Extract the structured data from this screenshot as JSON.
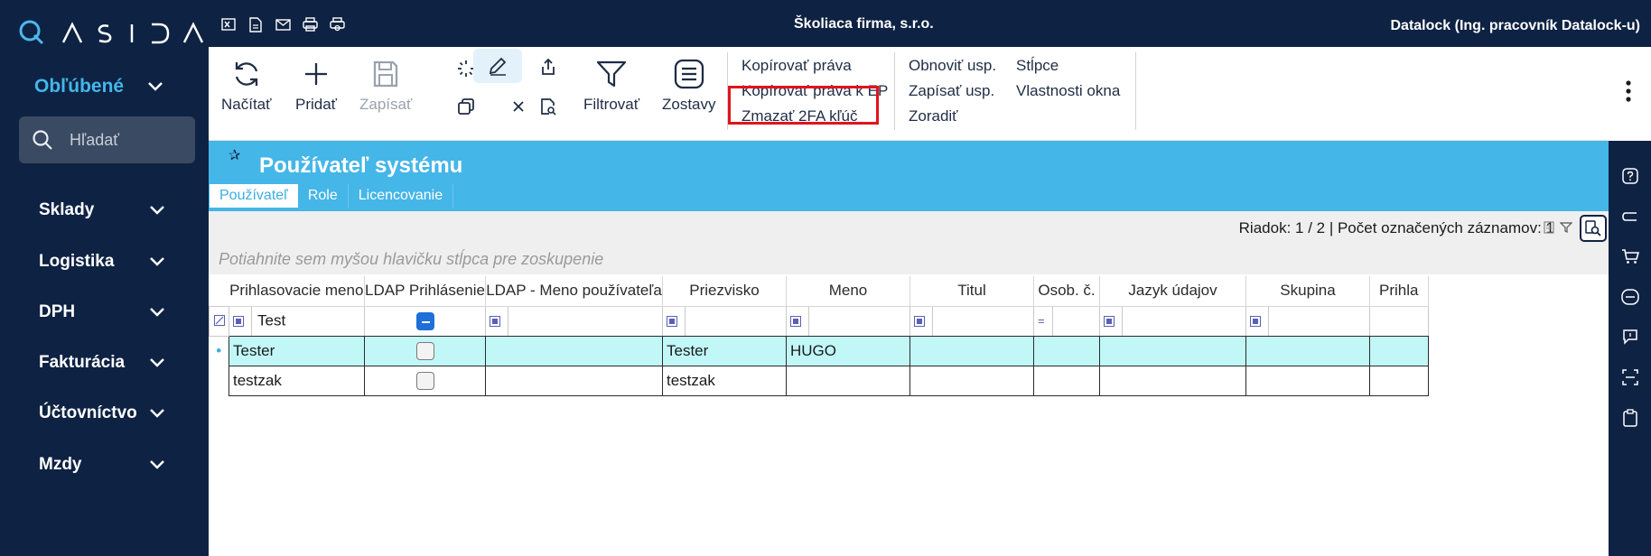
{
  "app": {
    "company": "Školiaca firma, s.r.o.",
    "user": "Datalock (Ing. pracovník Datalock-u)"
  },
  "sidebar": {
    "favorites_label": "Obľúbené",
    "search_placeholder": "Hľadať",
    "items": [
      {
        "label": "Sklady"
      },
      {
        "label": "Logistika"
      },
      {
        "label": "DPH"
      },
      {
        "label": "Fakturácia"
      },
      {
        "label": "Účtovníctvo"
      },
      {
        "label": "Mzdy"
      }
    ]
  },
  "ribbon": {
    "reload": "Načítať",
    "add": "Pridať",
    "save": "Zapísať",
    "filter": "Filtrovať",
    "reports": "Zostavy",
    "copy_rights": "Kopírovať práva",
    "copy_rights_ep": "Kopírovať práva k EP",
    "delete_2fa": "Zmazať 2FA kľúč",
    "refresh_settings": "Obnoviť usp.",
    "write_settings": "Zapísať usp.",
    "sort": "Zoradiť",
    "columns": "Stĺpce",
    "window_props": "Vlastnosti okna"
  },
  "page": {
    "title": "Používateľ systému",
    "tabs": [
      {
        "label": "Používateľ"
      },
      {
        "label": "Role"
      },
      {
        "label": "Licencovanie"
      }
    ]
  },
  "grid": {
    "row_info": "Riadok: 1 / 2 | Počet označených záznamov: 1",
    "group_hint": "Potiahnite sem myšou hlavičku stĺpca pre zoskupenie",
    "columns": [
      "Prihlasovacie meno",
      "LDAP Prihlásenie",
      "LDAP - Meno používateľa",
      "Priezvisko",
      "Meno",
      "Titul",
      "Osob. č.",
      "Jazyk údajov",
      "Skupina",
      "Prihla"
    ],
    "filter_value": "Test",
    "rows": [
      {
        "login": "Tester",
        "ldap_user": "",
        "surname": "Tester",
        "name": "HUGO",
        "title": "",
        "osob": "",
        "lang": "",
        "group": ""
      },
      {
        "login": "testzak",
        "ldap_user": "",
        "surname": "testzak",
        "name": "",
        "title": "",
        "osob": "",
        "lang": "",
        "group": ""
      }
    ]
  },
  "colors": {
    "navy": "#0e2243",
    "accent": "#45b6e8",
    "selected_row": "#c2f7f8",
    "highlight": "#e0141e"
  }
}
